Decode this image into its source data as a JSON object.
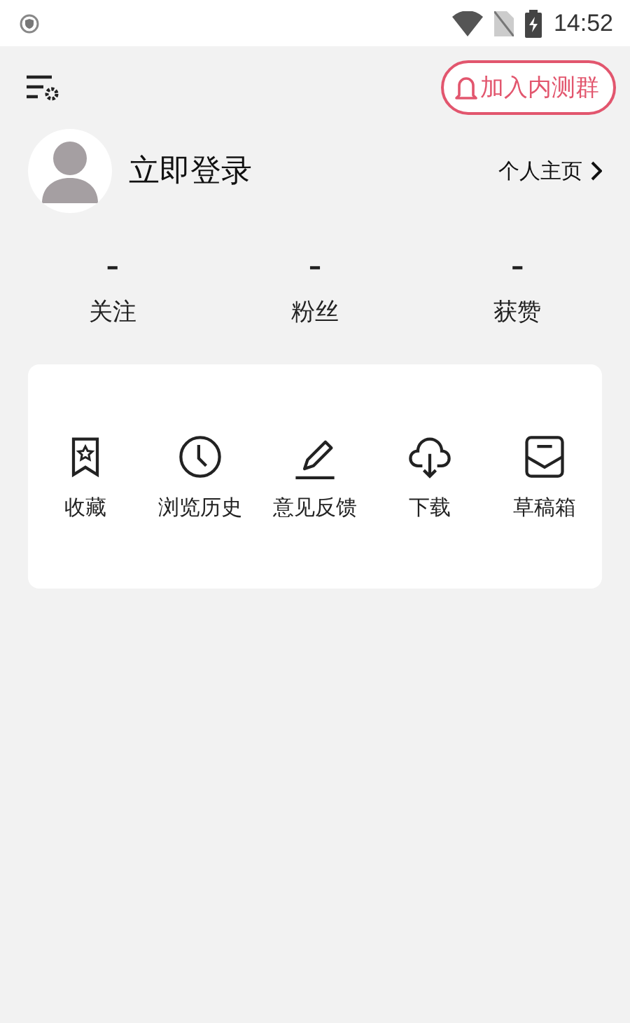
{
  "status_bar": {
    "time": "14:52"
  },
  "toolbar": {
    "join_button": "加入内测群"
  },
  "profile": {
    "name": "立即登录",
    "homepage_link": "个人主页"
  },
  "stats": [
    {
      "value": "–",
      "label": "关注"
    },
    {
      "value": "–",
      "label": "粉丝"
    },
    {
      "value": "–",
      "label": "获赞"
    }
  ],
  "actions": [
    {
      "kind": "favorites",
      "label": "收藏"
    },
    {
      "kind": "history",
      "label": "浏览历史"
    },
    {
      "kind": "feedback",
      "label": "意见反馈"
    },
    {
      "kind": "download",
      "label": "下载"
    },
    {
      "kind": "drafts",
      "label": "草稿箱"
    }
  ]
}
